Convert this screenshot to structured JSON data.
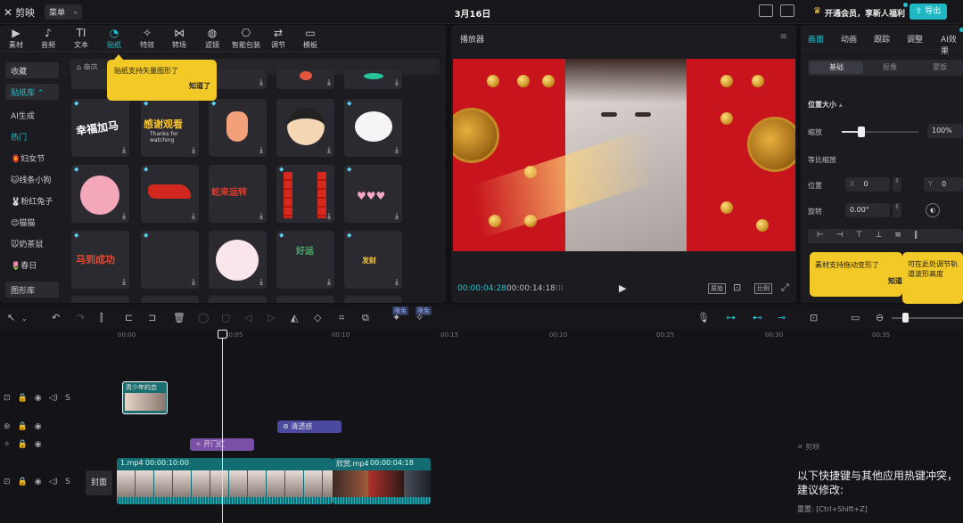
{
  "app": {
    "name": "剪映",
    "menu": "菜单",
    "date": "3月16日",
    "vip": "开通会员，享新人福利",
    "export": "导出"
  },
  "categories": [
    {
      "icon": "▶",
      "label": "素材"
    },
    {
      "icon": "♪",
      "label": "音频"
    },
    {
      "icon": "TI",
      "label": "文本"
    },
    {
      "icon": "◔",
      "label": "贴纸"
    },
    {
      "icon": "✧",
      "label": "特效"
    },
    {
      "icon": "⋈",
      "label": "转场"
    },
    {
      "icon": "◍",
      "label": "滤镜"
    },
    {
      "icon": "⎔",
      "label": "智能包装"
    },
    {
      "icon": "⇄",
      "label": "调节"
    },
    {
      "icon": "▭",
      "label": "模板"
    }
  ],
  "sidebar": [
    "收藏",
    "贴纸库",
    "AI生成",
    "热门",
    "🏮妇女节",
    "🐱线条小狗",
    "🐰粉红兔子",
    "😊猫猫",
    "🐭奶茶鼠",
    "🌷春日",
    "图形库"
  ],
  "shop_label": "商店",
  "tooltip_sticker": {
    "text": "贴纸支持矢量图形了",
    "ok": "知道了"
  },
  "player": {
    "title": "播放器",
    "time_current": "00:00:04:28",
    "time_total": "00:00:14:18",
    "full": "原始",
    "ratio": "比例"
  },
  "right_tabs": [
    "画面",
    "动画",
    "跟踪",
    "调整",
    "AI效果"
  ],
  "segments": [
    "基础",
    "抠像",
    "蒙版"
  ],
  "props": {
    "size_title": "位置大小",
    "scale_label": "缩放",
    "scale_value": "100%",
    "proportional": "等比缩放",
    "position_label": "位置",
    "x_label": "X",
    "x_value": "0",
    "y_label": "Y",
    "y_value": "0",
    "rotate_label": "旋转",
    "rotate_value": "0.00°"
  },
  "tooltip_right1": {
    "text": "素材支持拖动变形了",
    "ok": "知道"
  },
  "tooltip_right2": {
    "text": "可在此处调节轨道波形高度"
  },
  "badges": [
    "限免",
    "限免"
  ],
  "ruler": [
    "00:00",
    "00:05",
    "00:10",
    "00:15",
    "00:20",
    "00:25",
    "00:30",
    "00:35"
  ],
  "clips": {
    "sticker_clip": "青少年的恋",
    "filter_clip": "清透感",
    "effect_clip": "开门红",
    "video1_name": "1.mp4",
    "video1_dur": "00:00:10:00",
    "video2_name": "欣赏.mp4",
    "video2_dur": "00:00:04:18",
    "cover": "封面"
  },
  "hotkey": {
    "logo": "剪映",
    "text": "以下快捷键与其他应用热键冲突，建议修改:",
    "key": "重置: [Ctrl+Shift+Z]"
  },
  "colors": {
    "accent": "#1fc3d2",
    "tooltip": "#f3c927",
    "filter_clip": "#4b4aa0",
    "effect_clip": "#7a4fa6",
    "video_clip": "#136c72"
  }
}
